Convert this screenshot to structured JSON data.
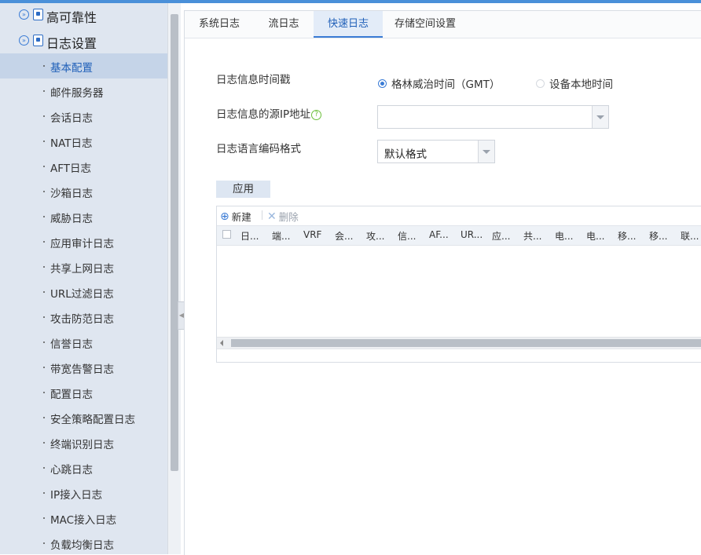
{
  "sidebar": {
    "groups": [
      {
        "label": "高可靠性"
      },
      {
        "label": "日志设置"
      }
    ],
    "items": [
      {
        "label": "基本配置"
      },
      {
        "label": "邮件服务器"
      },
      {
        "label": "会话日志"
      },
      {
        "label": "NAT日志"
      },
      {
        "label": "AFT日志"
      },
      {
        "label": "沙箱日志"
      },
      {
        "label": "威胁日志"
      },
      {
        "label": "应用审计日志"
      },
      {
        "label": "共享上网日志"
      },
      {
        "label": "URL过滤日志"
      },
      {
        "label": "攻击防范日志"
      },
      {
        "label": "信誉日志"
      },
      {
        "label": "带宽告警日志"
      },
      {
        "label": "配置日志"
      },
      {
        "label": "安全策略配置日志"
      },
      {
        "label": "终端识别日志"
      },
      {
        "label": "心跳日志"
      },
      {
        "label": "IP接入日志"
      },
      {
        "label": "MAC接入日志"
      },
      {
        "label": "负载均衡日志"
      }
    ],
    "active_index": 0
  },
  "tabs": [
    {
      "label": "系统日志"
    },
    {
      "label": "流日志"
    },
    {
      "label": "快速日志"
    },
    {
      "label": "存储空间设置"
    }
  ],
  "active_tab": 2,
  "form": {
    "timestamp_label": "日志信息时间戳",
    "timestamp_options": [
      {
        "label": "格林威治时间（GMT）",
        "selected": true
      },
      {
        "label": "设备本地时间",
        "selected": false
      }
    ],
    "source_ip_label": "日志信息的源IP地址",
    "source_ip_help": "?",
    "source_ip_value": "",
    "encoding_label": "日志语言编码格式",
    "encoding_value": "默认格式",
    "apply_label": "应用"
  },
  "table": {
    "new_label": "新建",
    "delete_label": "删除",
    "columns": [
      "日...",
      "端...",
      "VRF",
      "会...",
      "攻...",
      "信...",
      "AF...",
      "UR...",
      "应...",
      "共...",
      "电...",
      "电...",
      "移...",
      "移...",
      "联..."
    ]
  },
  "colors": {
    "accent": "#3a7bd5",
    "sidebar_bg": "#dfe6f0",
    "sidebar_active": "#c5d4e8",
    "help_green": "#6cbf3b"
  }
}
